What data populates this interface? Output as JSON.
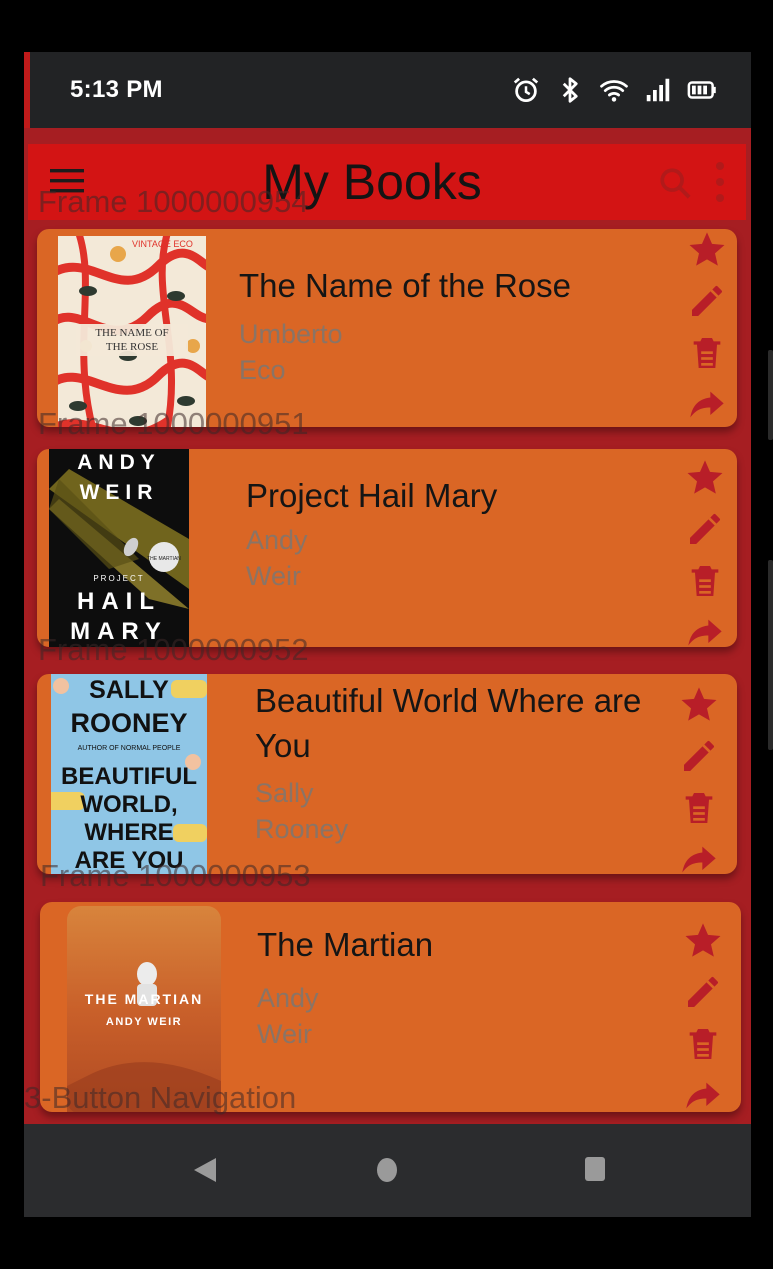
{
  "status_bar": {
    "time": "5:13 PM",
    "icons": [
      "alarm-icon",
      "bluetooth-icon",
      "wifi-icon",
      "cellular-signal-icon",
      "battery-icon"
    ]
  },
  "app_bar": {
    "title": "My Books",
    "icons": [
      "menu-icon",
      "search-icon",
      "more-vert-icon"
    ]
  },
  "frame_labels": {
    "frame_954": "Frame 1000000954",
    "frame_951": "Frame 1000000951",
    "frame_952": "Frame 1000000952",
    "frame_953": "Frame 1000000953",
    "nav_label": "3-Button Navigation"
  },
  "books": [
    {
      "title": "The Name of the Rose",
      "author_first": "Umberto",
      "author_last": "Eco",
      "cover_text": [
        "VINTAGE ECO",
        "THE NAME OF",
        "THE ROSE"
      ]
    },
    {
      "title": "Project Hail Mary",
      "author_first": "Andy",
      "author_last": "Weir",
      "cover_text": [
        "ANDY",
        "WEIR",
        "PROJECT",
        "HAIL",
        "MARY",
        "THE MARTIAN"
      ]
    },
    {
      "title": "Beautiful World Where are You",
      "author_first": "Sally",
      "author_last": "Rooney",
      "cover_text": [
        "SALLY",
        "ROONEY",
        "AUTHOR OF NORMAL PEOPLE",
        "BEAUTIFUL",
        "WORLD,",
        "WHERE",
        "ARE YOU"
      ]
    },
    {
      "title": "The Martian",
      "author_first": "Andy",
      "author_last": "Weir",
      "cover_text": [
        "THE MARTIAN",
        "ANDY WEIR"
      ]
    }
  ],
  "card_actions": [
    "star-icon",
    "edit-icon",
    "delete-icon",
    "share-icon"
  ],
  "nav_bar": {
    "buttons": [
      "back-icon",
      "home-icon",
      "recents-icon"
    ]
  },
  "colors": {
    "screen_bg": "#a61e22",
    "app_bar": "#d31414",
    "card": "#da6625",
    "action_icon": "#b81e28",
    "status_bar": "#222325",
    "nav_bar": "#2b2c2e"
  }
}
